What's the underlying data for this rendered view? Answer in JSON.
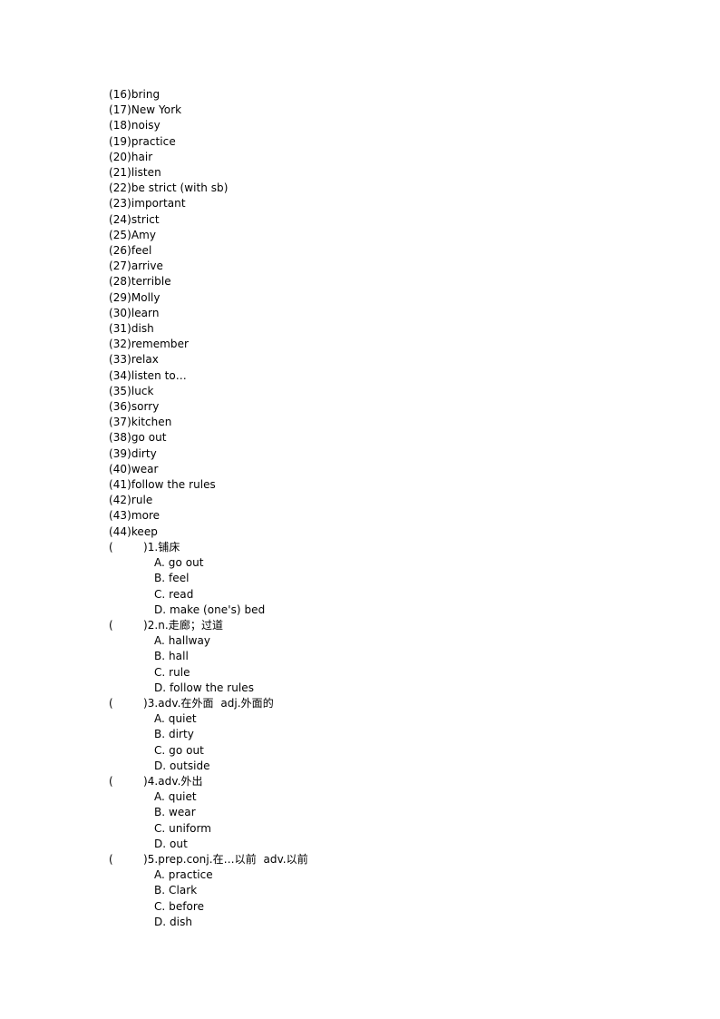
{
  "page": {
    "background_color": "#ffffff",
    "text_color": "#000000"
  },
  "vocabulary": {
    "items": [
      "(16)bring",
      "(17)New York",
      "(18)noisy",
      "(19)practice",
      "(20)hair",
      "(21)listen",
      "(22)be strict (with sb)",
      "(23)important",
      "(24)strict",
      "(25)Amy",
      "(26)feel",
      "(27)arrive",
      "(28)terrible",
      "(29)Molly",
      "(30)learn",
      "(31)dish",
      "(32)remember",
      "(33)relax",
      "(34)listen to…",
      "(35)luck",
      "(36)sorry",
      "(37)kitchen",
      "(38)go out",
      "(39)dirty",
      "(40)wear",
      "(41)follow the rules",
      "(42)rule",
      "(43)more",
      "(44)keep"
    ]
  },
  "questions": [
    {
      "bracket_open": "(",
      "stem": ")1.铺床",
      "options": [
        "A. go out",
        "B. feel",
        "C. read",
        "D. make (one's) bed"
      ]
    },
    {
      "bracket_open": "(",
      "stem": ")2.n.走廊；过道",
      "options": [
        "A. hallway",
        "B. hall",
        "C. rule",
        "D. follow the rules"
      ]
    },
    {
      "bracket_open": "(",
      "stem": ")3.adv.在外面  adj.外面的",
      "options": [
        "A. quiet",
        "B. dirty",
        "C. go out",
        "D. outside"
      ]
    },
    {
      "bracket_open": "(",
      "stem": ")4.adv.外出",
      "options": [
        "A. quiet",
        "B. wear",
        "C. uniform",
        "D. out"
      ]
    },
    {
      "bracket_open": "(",
      "stem": ")5.prep.conj.在…以前  adv.以前",
      "options": [
        "A. practice",
        "B. Clark",
        "C. before",
        "D. dish"
      ]
    }
  ]
}
